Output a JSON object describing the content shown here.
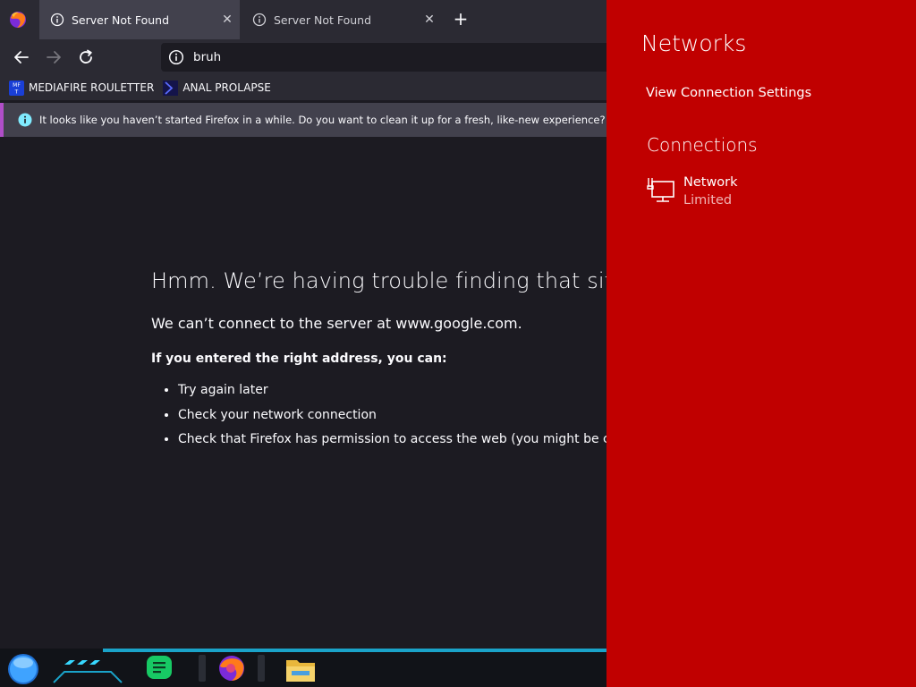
{
  "browser": {
    "tabs": [
      {
        "title": "Server Not Found",
        "active": true
      },
      {
        "title": "Server Not Found",
        "active": false
      }
    ],
    "url": "bruh",
    "bookmarks": [
      {
        "label": "MEDIAFIRE ROULETTER",
        "icon": "mediafire-icon"
      },
      {
        "label": "ANAL PROLAPSE",
        "icon": "sigma-icon"
      }
    ],
    "notice": "It looks like you haven’t started Firefox in a while. Do you want to clean it up for a fresh, like-new experience? And by the way, welcome back!"
  },
  "error_page": {
    "title": "Hmm. We’re having trouble finding that site.",
    "description": "We can’t connect to the server at www.google.com.",
    "subtitle": "If you entered the right address, you can:",
    "suggestions": [
      "Try again later",
      "Check your network connection",
      "Check that Firefox has permission to access the web (you might be connected but behind a firewall)"
    ]
  },
  "taskbar": {
    "items": [
      "start-orb-icon",
      "task-view-icon",
      "chat-app-icon",
      "firefox-icon",
      "file-explorer-icon"
    ]
  },
  "network_flyout": {
    "title": "Networks",
    "settings_link": "View Connection Settings",
    "section": "Connections",
    "connection": {
      "name": "Network",
      "status": "Limited"
    }
  },
  "colors": {
    "flyout_bg": "#c00000",
    "browser_bg": "#1c1b22",
    "toolbar_bg": "#2b2a33",
    "accent_cyan": "#1aa3c9"
  }
}
